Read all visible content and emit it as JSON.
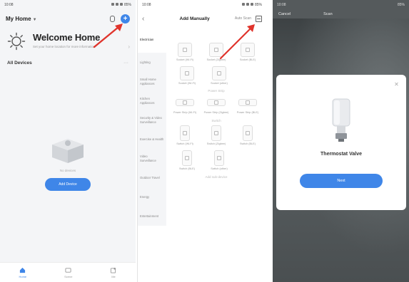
{
  "colors": {
    "accent": "#3f86e8",
    "arrow": "#e0342c"
  },
  "phone1": {
    "status_time": "10:08",
    "status_right": "85%",
    "home_name": "My Home",
    "welcome_title": "Welcome Home",
    "welcome_subtitle": "Set your home location for more information",
    "section_title": "All Devices",
    "empty_caption": "No devices",
    "add_device_button": "Add Device",
    "tabs": [
      {
        "label": "Home",
        "icon": "home-icon",
        "active": true
      },
      {
        "label": "Scene",
        "icon": "scene-icon",
        "active": false
      },
      {
        "label": "Me",
        "icon": "me-icon",
        "active": false
      }
    ]
  },
  "phone2": {
    "status_time": "10:08",
    "status_right": "85%",
    "title": "Add Manually",
    "auto_scan": "Auto Scan",
    "categories": [
      "Electrician",
      "Lighting",
      "Small Home Appliances",
      "Kitchen Appliances",
      "Security & Video Surveillance",
      "Exercise & Health",
      "Video Surveillance",
      "Outdoor Travel",
      "Energy",
      "Entertainment"
    ],
    "groups": [
      {
        "header": "",
        "devices": [
          {
            "name": "Socket (Wi-Fi)",
            "shape": "square"
          },
          {
            "name": "Socket (Zigbee)",
            "shape": "square"
          },
          {
            "name": "Socket (BLE)",
            "shape": "square"
          }
        ]
      },
      {
        "header": "",
        "devices": [
          {
            "name": "Socket (Wi-Fi)",
            "shape": "square"
          },
          {
            "name": "Socket (other)",
            "shape": "square"
          }
        ]
      },
      {
        "header": "Power Strip",
        "devices": [
          {
            "name": "Power Strip (Wi-Fi)",
            "shape": "wide"
          },
          {
            "name": "Power Strip (Zigbee)",
            "shape": "wide"
          },
          {
            "name": "Power Strip (BLE)",
            "shape": "wide"
          }
        ]
      },
      {
        "header": "Switch",
        "devices": [
          {
            "name": "Switch (Wi-Fi)",
            "shape": "tall"
          },
          {
            "name": "Switch (Zigbee)",
            "shape": "tall"
          },
          {
            "name": "Switch (BLE)",
            "shape": "tall"
          }
        ]
      },
      {
        "header": "",
        "devices": [
          {
            "name": "Switch (BLE)",
            "shape": "tall"
          },
          {
            "name": "Switch (other)",
            "shape": "tall"
          }
        ]
      }
    ],
    "bottom_header": "Add sub-device"
  },
  "phone3": {
    "status_time": "10:08",
    "status_right": "85%",
    "cancel": "Cancel",
    "title": "Scan",
    "device_name": "Thermostat Valve",
    "next_button": "Next"
  }
}
